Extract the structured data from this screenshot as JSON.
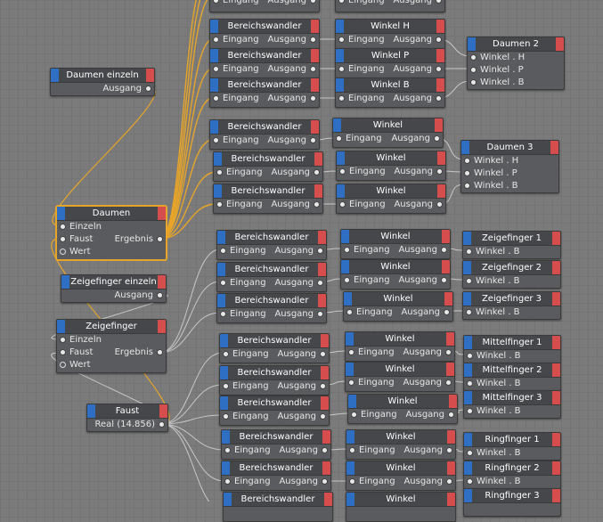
{
  "colors": {
    "background": "#7b7b7b",
    "node_body": "#5a5b5e",
    "node_header": "#46474b",
    "input_tab": "#2e6fc4",
    "output_tab": "#d54d4d",
    "selected_wire": "#e6a52a",
    "wire": "#c8c8c8"
  },
  "nodes": {
    "bw": {
      "title": "Bereichswandler",
      "input": "Eingang",
      "output": "Ausgang"
    },
    "w": {
      "title": "Winkel",
      "input": "Eingang",
      "output": "Ausgang"
    },
    "winkel_h": {
      "title": "Winkel H",
      "input": "Eingang",
      "output": "Ausgang"
    },
    "winkel_p": {
      "title": "Winkel P",
      "input": "Eingang",
      "output": "Ausgang"
    },
    "winkel_b": {
      "title": "Winkel B",
      "input": "Eingang",
      "output": "Ausgang"
    },
    "daumen_einzeln": {
      "title": "Daumen einzeln",
      "output": "Ausgang"
    },
    "zeigefinger_einzeln": {
      "title": "Zeigefinger einzeln",
      "output": "Ausgang"
    },
    "daumen": {
      "title": "Daumen",
      "ports": [
        "Einzeln",
        "Faust",
        "Wert"
      ],
      "output": "Ergebnis"
    },
    "zeigefinger": {
      "title": "Zeigefinger",
      "ports": [
        "Einzeln",
        "Faust",
        "Wert"
      ],
      "output": "Ergebnis"
    },
    "faust": {
      "title": "Faust",
      "value": "Real (14.856)"
    },
    "daumen_2": {
      "title": "Daumen 2",
      "ports": [
        "Winkel . H",
        "Winkel . P",
        "Winkel . B"
      ]
    },
    "daumen_3": {
      "title": "Daumen 3",
      "ports": [
        "Winkel . H",
        "Winkel . P",
        "Winkel . B"
      ]
    },
    "zeigefinger_1": {
      "title": "Zeigefinger 1",
      "port": "Winkel . B"
    },
    "zeigefinger_2": {
      "title": "Zeigefinger 2",
      "port": "Winkel . B"
    },
    "zeigefinger_3": {
      "title": "Zeigefinger 3",
      "port": "Winkel . B"
    },
    "mittelfinger_1": {
      "title": "Mittelfinger 1",
      "port": "Winkel . B"
    },
    "mittelfinger_2": {
      "title": "Mittelfinger 2",
      "port": "Winkel . B"
    },
    "mittelfinger_3": {
      "title": "Mittelfinger 3",
      "port": "Winkel . B"
    },
    "ringfinger_1": {
      "title": "Ringfinger 1",
      "port": "Winkel . B"
    },
    "ringfinger_2": {
      "title": "Ringfinger 2",
      "port": "Winkel . B"
    },
    "ringfinger_3": {
      "title": "Ringfinger 3"
    }
  }
}
